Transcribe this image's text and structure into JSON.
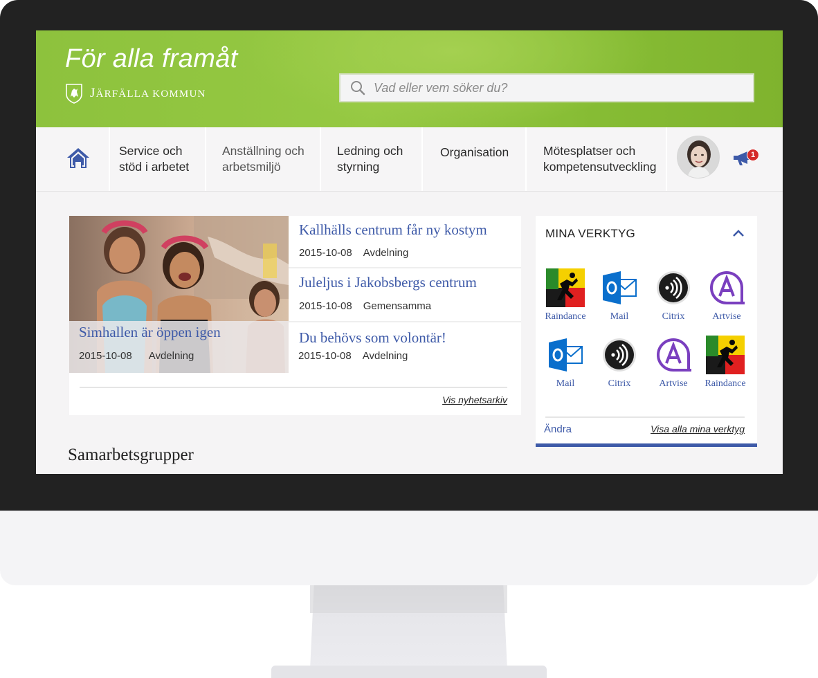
{
  "header": {
    "tagline": "För alla framåt",
    "logo_text_first": "J",
    "logo_text_rest": "ÄRFÄLLA KOMMUN",
    "search_placeholder": "Vad eller vem söker du?"
  },
  "nav": {
    "home_icon": "home-icon",
    "items": [
      {
        "label": "Service och\nstöd i arbetet"
      },
      {
        "label": "Anställning och\narbetsmiljö"
      },
      {
        "label": "Ledning och\nstyrning"
      },
      {
        "label": "Organisation"
      },
      {
        "label": "Mötesplatser och\nkompetensutveckling"
      }
    ],
    "notification_count": "1"
  },
  "news": {
    "featured": {
      "title": "Simhallen är öppen igen",
      "date": "2015-10-08",
      "category": "Avdelning"
    },
    "items": [
      {
        "title": "Kallhälls centrum får ny kostym",
        "date": "2015-10-08",
        "category": "Avdelning"
      },
      {
        "title": "Juleljus i Jakobsbergs centrum",
        "date": "2015-10-08",
        "category": "Gemensamma"
      },
      {
        "title": "Du behövs som volontär!",
        "date": "2015-10-08",
        "category": "Avdelning"
      }
    ],
    "archive_link": "Vis nyhetsarkiv"
  },
  "tools": {
    "title": "MINA VERKTYG",
    "items": [
      {
        "label": "Raindance",
        "icon": "raindance-icon"
      },
      {
        "label": "Mail",
        "icon": "mail-icon"
      },
      {
        "label": "Citrix",
        "icon": "citrix-icon"
      },
      {
        "label": "Artvise",
        "icon": "artvise-icon"
      },
      {
        "label": "Mail",
        "icon": "mail-icon"
      },
      {
        "label": "Citrix",
        "icon": "citrix-icon"
      },
      {
        "label": "Artvise",
        "icon": "artvise-icon"
      },
      {
        "label": "Raindance",
        "icon": "raindance-icon"
      }
    ],
    "edit_link": "Ändra",
    "all_link": "Visa alla mina verktyg"
  },
  "section_title": "Samarbetsgrupper",
  "colors": {
    "brand_green": "#8dc23d",
    "link_blue": "#3e5aa8",
    "badge_red": "#d42a2a"
  }
}
